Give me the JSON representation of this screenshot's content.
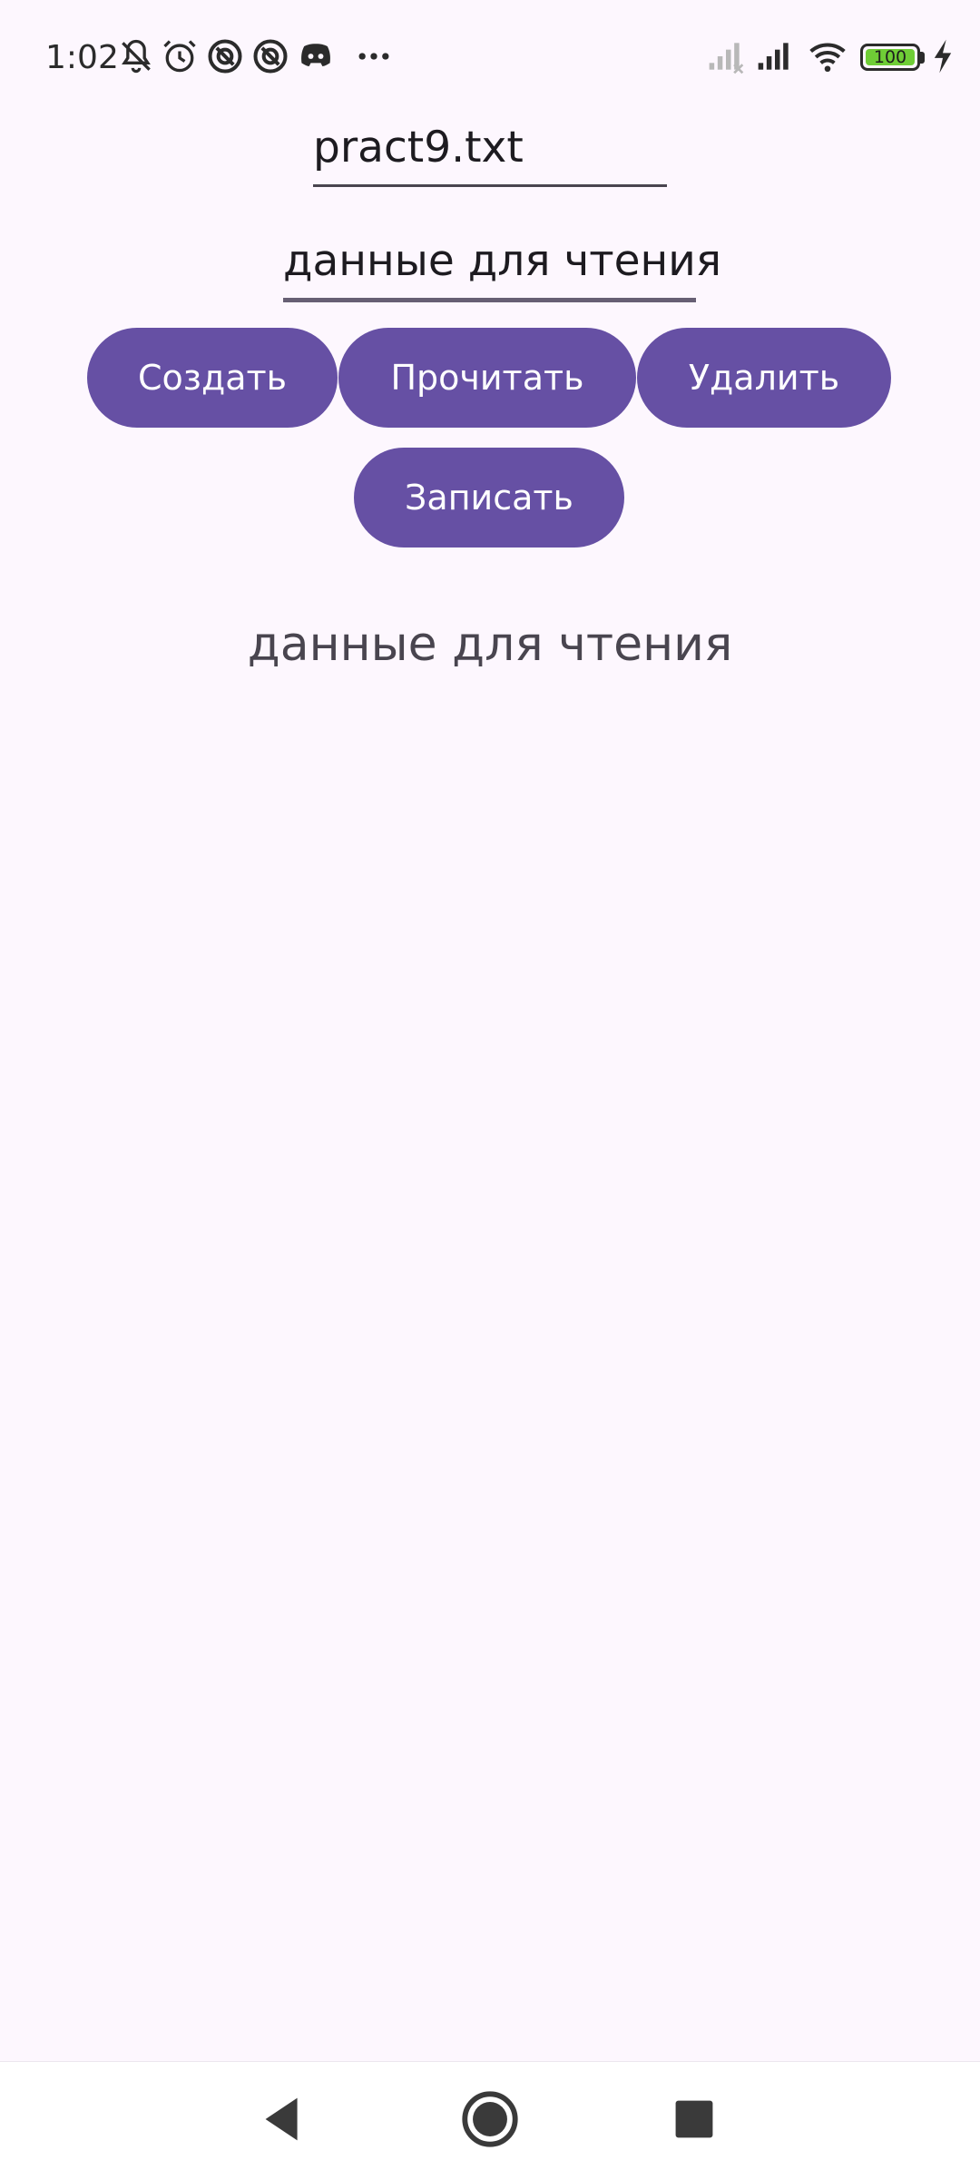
{
  "status_bar": {
    "time": "1:02",
    "battery_level": "100",
    "battery_fraction": 1.0,
    "battery_color": "#6fcd36",
    "icons": [
      "bell-off-icon",
      "alarm-icon",
      "app-notification-icon",
      "app-notification-icon",
      "discord-icon",
      "more-dots-icon",
      "signal-none-icon",
      "signal-full-icon",
      "wifi-icon",
      "battery-icon",
      "charging-bolt-icon"
    ]
  },
  "form": {
    "filename_value": "pract9.txt",
    "data_value": "данные для чтения"
  },
  "buttons": {
    "create_label": "Создать",
    "read_label": "Прочитать",
    "delete_label": "Удалить",
    "write_label": "Записать"
  },
  "output": {
    "text": "данные для чтения"
  },
  "nav_bar": {
    "icons": [
      "back-icon",
      "home-icon",
      "recents-icon"
    ]
  },
  "colors": {
    "background": "#fdf7fe",
    "primary": "#6650a4",
    "on_primary": "#ffffff",
    "text": "#1d1b20",
    "secondary_text": "#49454f"
  }
}
